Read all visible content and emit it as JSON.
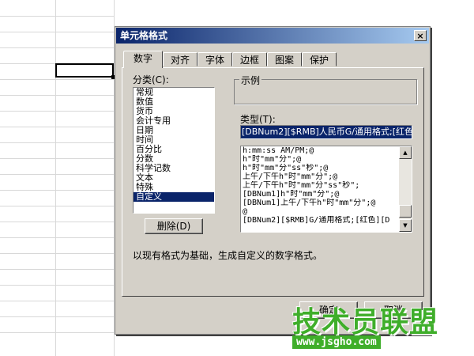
{
  "dialog": {
    "title": "单元格格式",
    "close_label": "×",
    "tabs": [
      {
        "label": "数字"
      },
      {
        "label": "对齐"
      },
      {
        "label": "字体"
      },
      {
        "label": "边框"
      },
      {
        "label": "图案"
      },
      {
        "label": "保护"
      }
    ],
    "active_tab": "数字",
    "category_label": "分类(C):",
    "categories": [
      "常规",
      "数值",
      "货币",
      "会计专用",
      "日期",
      "时间",
      "百分比",
      "分数",
      "科学记数",
      "文本",
      "特殊",
      "自定义"
    ],
    "selected_category": "自定义",
    "sample_label": "示例",
    "type_label": "类型(T):",
    "type_value": "[DBNum2][$RMB]人民币G/通用格式;[红色]",
    "formats": [
      "h:mm:ss AM/PM;@",
      "h\"时\"mm\"分\";@",
      "h\"时\"mm\"分\"ss\"秒\";@",
      "上午/下午h\"时\"mm\"分\";@",
      "上午/下午h\"时\"mm\"分\"ss\"秒\";",
      "[DBNum1]h\"时\"mm\"分\";@",
      "[DBNum1]上午/下午h\"时\"mm\"分\";@",
      "@",
      "[DBNum2][$RMB]G/通用格式;[红色][D"
    ],
    "delete_button": "删除(D)",
    "description": "以现有格式为基础，生成自定义的数字格式。",
    "ok_button": "确定",
    "cancel_button": "取消"
  },
  "watermark": {
    "logo_text": "技术员联盟",
    "url": "www.jsgho.com"
  }
}
